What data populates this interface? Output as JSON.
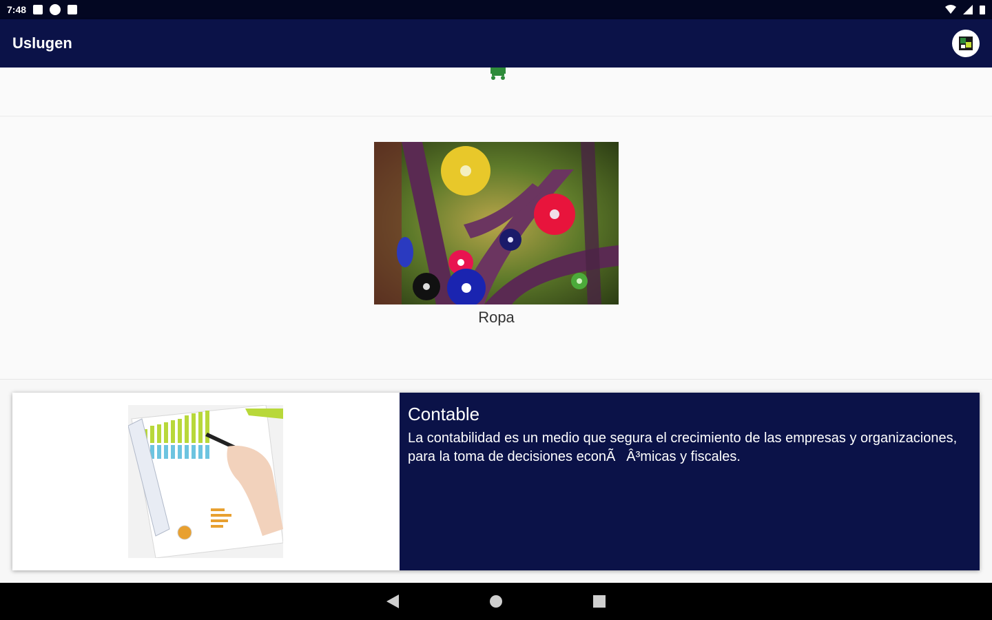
{
  "status_bar": {
    "time": "7:48"
  },
  "app_bar": {
    "title": "Uslugen"
  },
  "categories": [
    {
      "label": "Ropa"
    }
  ],
  "services": [
    {
      "title": "Contable",
      "description": "La contabilidad es un medio que segura el crecimiento de las empresas y organizaciones,  para la toma de decisiones econÃÂ³micas y fiscales."
    }
  ],
  "colors": {
    "primary": "#0b1248",
    "status_bar": "#030722",
    "cart_icon": "#2e8b3a"
  }
}
